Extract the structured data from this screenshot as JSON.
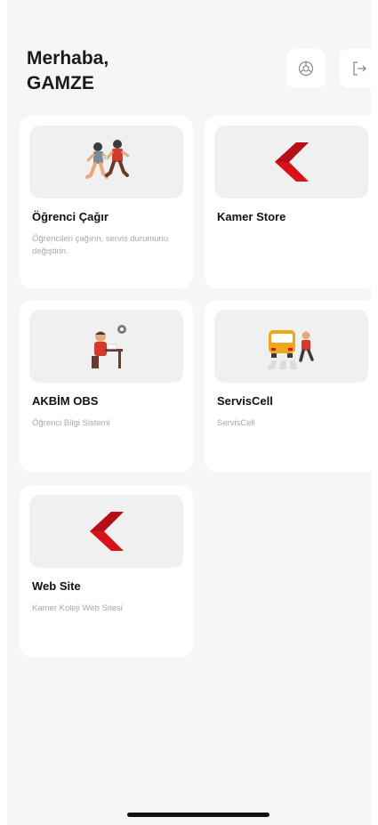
{
  "header": {
    "greeting_line1": "Merhaba,",
    "greeting_line2": "GAMZE",
    "settings_icon": "settings-icon",
    "logout_icon": "logout-icon"
  },
  "cards": [
    {
      "title": "Öğrenci Çağır",
      "description": "Öğrencileri çağırın, servis durumunu değiştirin.",
      "icon": "running-kids-icon"
    },
    {
      "title": "Kamer Store",
      "description": "",
      "icon": "kamer-logo-icon"
    },
    {
      "title": "AKBİM OBS",
      "description": "Öğrenci Bilgi Sistemi",
      "icon": "student-desk-icon"
    },
    {
      "title": "ServisCell",
      "description": "ServisCell",
      "icon": "school-bus-icon"
    },
    {
      "title": "Web Site",
      "description": "Kamer Koleji Web Sitesi",
      "icon": "kamer-logo-icon"
    }
  ],
  "colors": {
    "background": "#f6f6f6",
    "card": "#ffffff",
    "thumb": "#f0f0f0",
    "brand_red": "#d8121b"
  }
}
